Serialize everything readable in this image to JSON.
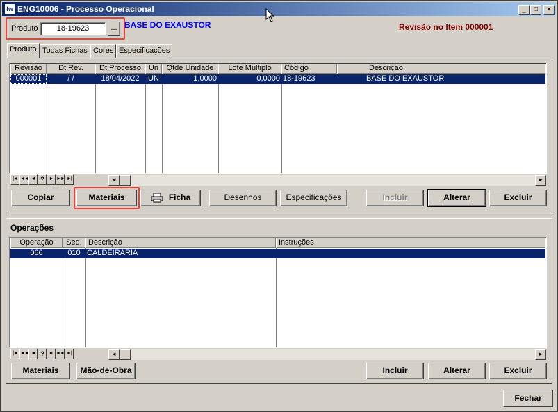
{
  "window": {
    "title": "ENG10006 - Processo Operacional",
    "app_icon": "fw",
    "minimize": "_",
    "maximize": "□",
    "close": "×"
  },
  "product": {
    "label": "Produto",
    "value": "18-19623",
    "lookup_label": "...",
    "description": "BASE DO EXAUSTOR",
    "revision_info": "Revisão no Item 000001"
  },
  "tabs": [
    {
      "label": "Produto"
    },
    {
      "label": "Todas Fichas"
    },
    {
      "label": "Cores"
    },
    {
      "label": "Especificações"
    }
  ],
  "revisions_grid": {
    "columns": [
      "Revisão",
      "Dt.Rev.",
      "Dt.Processo",
      "Un",
      "Qtde Unidade",
      "Lote Multiplo",
      "Código",
      "Descrição"
    ],
    "rows": [
      {
        "revisao": "000001",
        "dt_rev": "/  /",
        "dt_processo": "18/04/2022",
        "un": "UN",
        "qtde": "1,0000",
        "lote": "0,0000",
        "codigo": "18-19623",
        "descricao": "BASE DO EXAUSTOR"
      }
    ]
  },
  "navigator": [
    "|◄",
    "◄◄",
    "◄",
    "?",
    "►",
    "►►",
    "►|"
  ],
  "product_buttons": {
    "copiar": "Copiar",
    "materiais": "Materiais",
    "ficha": "Ficha",
    "desenhos": "Desenhos",
    "especificacoes": "Especificações",
    "incluir": "Incluir",
    "alterar": "Alterar",
    "excluir": "Excluir"
  },
  "operations": {
    "title": "Operações",
    "columns": [
      "Operação",
      "Seq.",
      "Descrição",
      "Instruções"
    ],
    "rows": [
      {
        "operacao": "066",
        "seq": "010",
        "descricao": "CALDEIRARIA",
        "instrucoes": ""
      }
    ]
  },
  "operation_buttons": {
    "materiais": "Materiais",
    "mao_de_obra": "Mão-de-Obra",
    "incluir": "Incluir",
    "alterar": "Alterar",
    "excluir": "Excluir"
  },
  "footer": {
    "fechar": "Fechar"
  },
  "colors": {
    "selection": "#0a246a",
    "description": "#0000ff",
    "revision": "#800000",
    "highlight": "#e8423a"
  }
}
